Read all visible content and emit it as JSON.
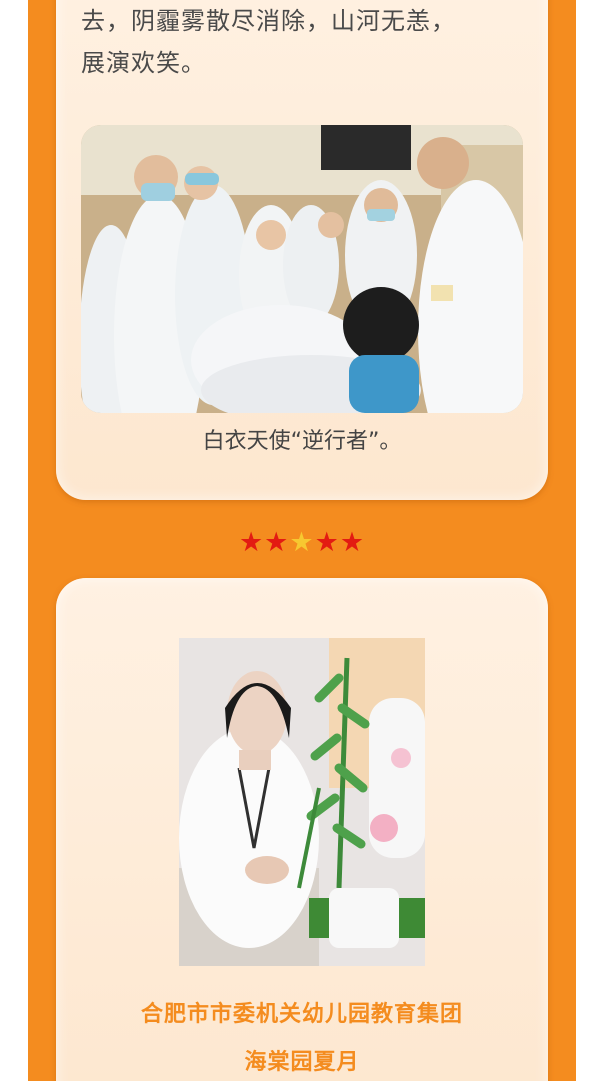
{
  "article": {
    "intro_text": "去，阴霾雾散尽消除，山河无恙，\n展演欢笑。",
    "photo_1_caption": "白衣天使“逆行者”。",
    "divider_stars": [
      "★",
      "★",
      "★",
      "★",
      "★"
    ],
    "school": "合肥市市委机关幼儿园教育集团",
    "author": "海棠园夏月"
  },
  "colors": {
    "background_orange": "#f48c1f",
    "card_cream": "#fdecd9",
    "star_red": "#e31b12",
    "star_gold": "#f7c830",
    "accent_text": "#f48c1f"
  }
}
